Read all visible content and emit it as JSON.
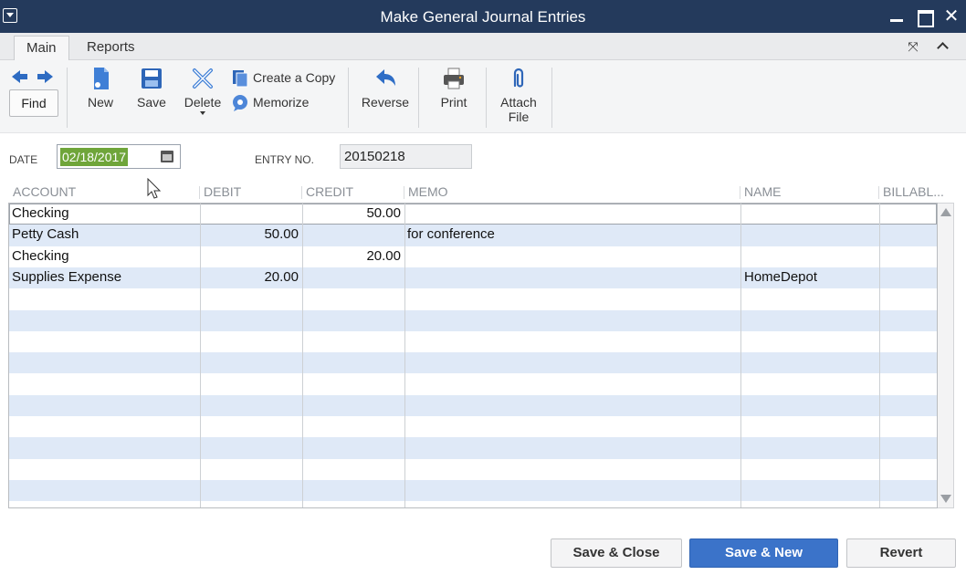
{
  "window": {
    "title": "Make General Journal Entries"
  },
  "tabs": [
    {
      "label": "Main",
      "active": true
    },
    {
      "label": "Reports",
      "active": false
    }
  ],
  "toolbar": {
    "find": "Find",
    "new": "New",
    "save": "Save",
    "delete": "Delete",
    "create_copy": "Create a Copy",
    "memorize": "Memorize",
    "reverse": "Reverse",
    "print": "Print",
    "attach_line1": "Attach",
    "attach_line2": "File",
    "accent_color": "#2d6bc2"
  },
  "header": {
    "date_label": "DATE",
    "date_value": "02/18/2017",
    "entry_label": "ENTRY NO.",
    "entry_value": "20150218"
  },
  "grid": {
    "columns": [
      "ACCOUNT",
      "DEBIT",
      "CREDIT",
      "MEMO",
      "NAME",
      "BILLABL..."
    ],
    "rows": [
      {
        "account": "Checking",
        "debit": "",
        "credit": "50.00",
        "memo": "",
        "name": ""
      },
      {
        "account": "Petty Cash",
        "debit": "50.00",
        "credit": "",
        "memo": "for conference",
        "name": ""
      },
      {
        "account": "Checking",
        "debit": "",
        "credit": "20.00",
        "memo": "",
        "name": ""
      },
      {
        "account": "Supplies Expense",
        "debit": "20.00",
        "credit": "",
        "memo": "",
        "name": "HomeDepot"
      }
    ],
    "alt_row_color": "#dfe9f7"
  },
  "buttons": {
    "save_close": "Save & Close",
    "save_new": "Save & New",
    "revert": "Revert",
    "primary_color": "#3b73c9"
  }
}
